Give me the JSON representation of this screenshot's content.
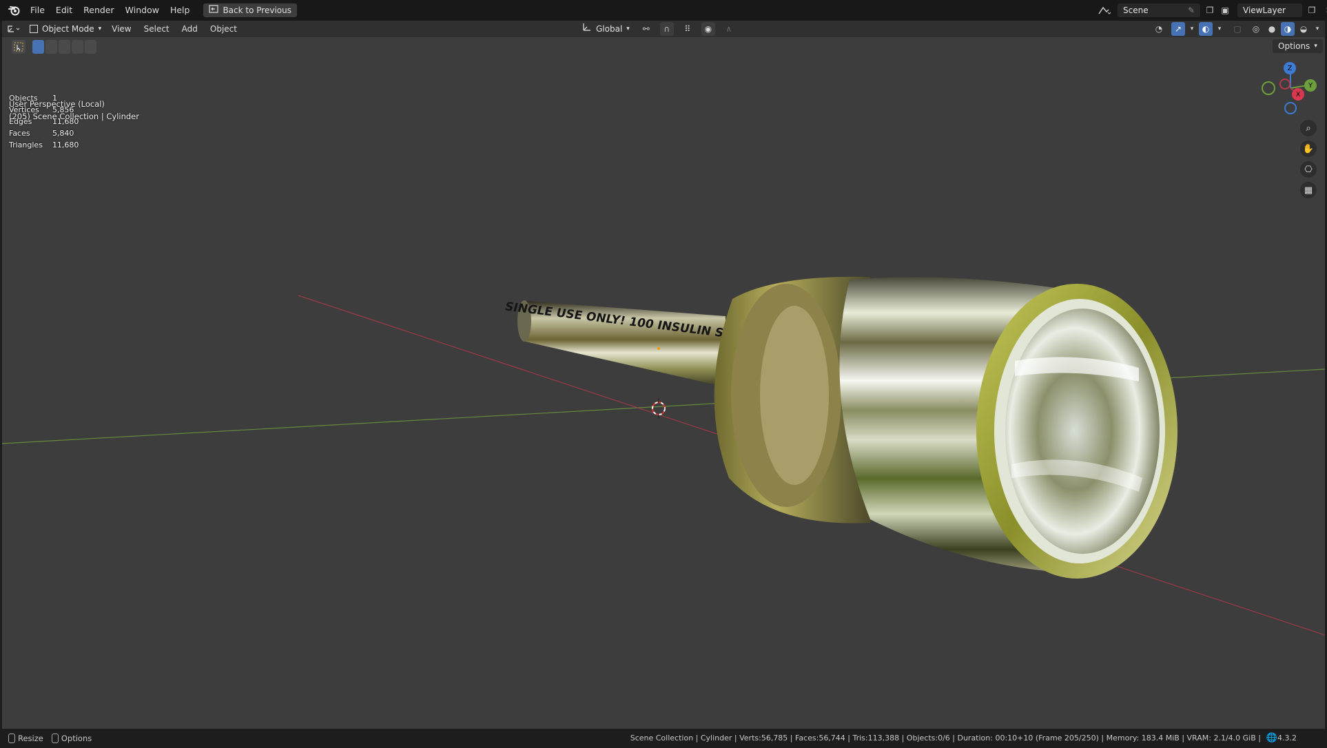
{
  "topbar": {
    "menus": [
      "File",
      "Edit",
      "Render",
      "Window",
      "Help"
    ],
    "back_button": "Back to Previous",
    "scene_name": "Scene",
    "view_layer": "ViewLayer"
  },
  "header": {
    "mode": "Object Mode",
    "menus": [
      "View",
      "Select",
      "Add",
      "Object"
    ],
    "orientation": "Global",
    "options": "Options"
  },
  "viewport": {
    "perspective": "User Perspective (Local)",
    "collection_info": "(205) Scene Collection | Cylinder",
    "stats": [
      {
        "label": "Objects",
        "value": "1"
      },
      {
        "label": "Vertices",
        "value": "5,856"
      },
      {
        "label": "Edges",
        "value": "11,680"
      },
      {
        "label": "Faces",
        "value": "5,840"
      },
      {
        "label": "Triangles",
        "value": "11,680"
      }
    ],
    "gizmo": {
      "z": "Z",
      "y": "Y",
      "x": "X"
    },
    "tube_text": "SINGLE USE ONLY! 100 INSULIN S Z"
  },
  "statusbar": {
    "resize": "Resize",
    "options": "Options",
    "info": "Scene Collection | Cylinder | Verts:56,785 | Faces:56,744 | Tris:113,388 | Objects:0/6 | Duration: 00:10+10 (Frame 205/250) | Memory: 183.4 MiB | VRAM: 2.1/4.0 GiB |",
    "version": "4.3.2"
  },
  "colors": {
    "axis_x": "#b5394a",
    "axis_y": "#6f9e3c",
    "axis_z": "#3d7bd4",
    "viewport_bg": "#3d3d3d"
  }
}
